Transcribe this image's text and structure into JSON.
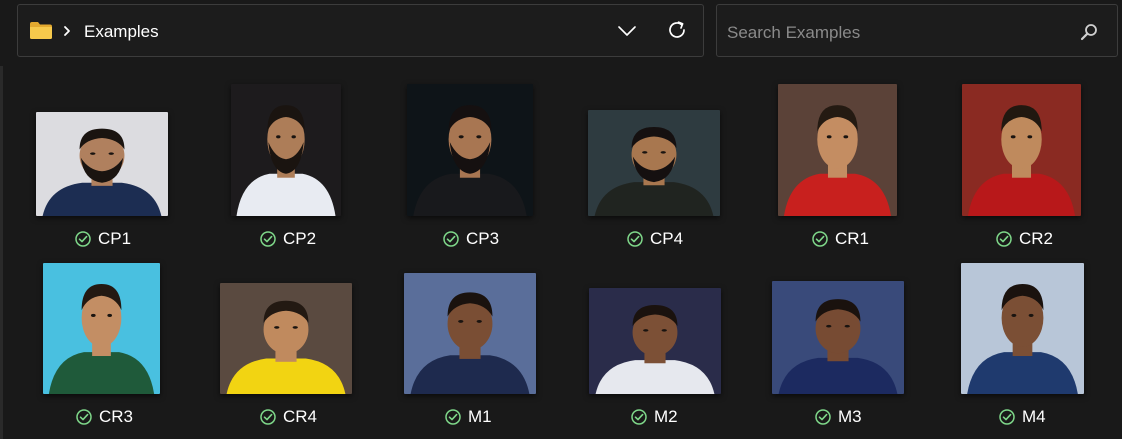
{
  "address_bar": {
    "folder_icon": "folder-icon",
    "current_folder": "Examples"
  },
  "search": {
    "placeholder": "Search Examples"
  },
  "colors": {
    "background": "#191919",
    "status_ok": "#7fd88a"
  },
  "items": [
    {
      "label": "CP1",
      "skin": "#b0805e",
      "hair": "#1a1410",
      "shirt": "#1c2d52",
      "bg": "#dcdce0",
      "beard": true
    },
    {
      "label": "CP2",
      "skin": "#ad7d58",
      "hair": "#1a1410",
      "shirt": "#e8ebf2",
      "bg": "#1d1b1d",
      "beard": true
    },
    {
      "label": "CP3",
      "skin": "#a87652",
      "hair": "#151010",
      "shirt": "#18191c",
      "bg": "#0e1418",
      "beard": true
    },
    {
      "label": "CP4",
      "skin": "#a8774f",
      "hair": "#151010",
      "shirt": "#202420",
      "bg": "#2e3b40",
      "beard": true
    },
    {
      "label": "CR1",
      "skin": "#c48d62",
      "hair": "#241a12",
      "shirt": "#c8201e",
      "bg": "#5b4238",
      "beard": false
    },
    {
      "label": "CR2",
      "skin": "#bf8a5d",
      "hair": "#211810",
      "shirt": "#b8181a",
      "bg": "#8a2a22",
      "beard": false
    },
    {
      "label": "CR3",
      "skin": "#c38e64",
      "hair": "#231912",
      "shirt": "#1f5a3a",
      "bg": "#49c0e0",
      "beard": false
    },
    {
      "label": "CR4",
      "skin": "#c08a5e",
      "hair": "#231912",
      "shirt": "#f2d412",
      "bg": "#5a4a40",
      "beard": false
    },
    {
      "label": "M1",
      "skin": "#7a4e34",
      "hair": "#1a120e",
      "shirt": "#1e2a4e",
      "bg": "#5a6e9a",
      "beard": false
    },
    {
      "label": "M2",
      "skin": "#7c5036",
      "hair": "#1a120e",
      "shirt": "#e6e8ee",
      "bg": "#2a2c4a",
      "beard": false
    },
    {
      "label": "M3",
      "skin": "#774b33",
      "hair": "#1a120e",
      "shirt": "#1c2a60",
      "bg": "#394a7a",
      "beard": false
    },
    {
      "label": "M4",
      "skin": "#7b4f35",
      "hair": "#1a120e",
      "shirt": "#1f3a6e",
      "bg": "#b8c6d8",
      "beard": false
    }
  ]
}
